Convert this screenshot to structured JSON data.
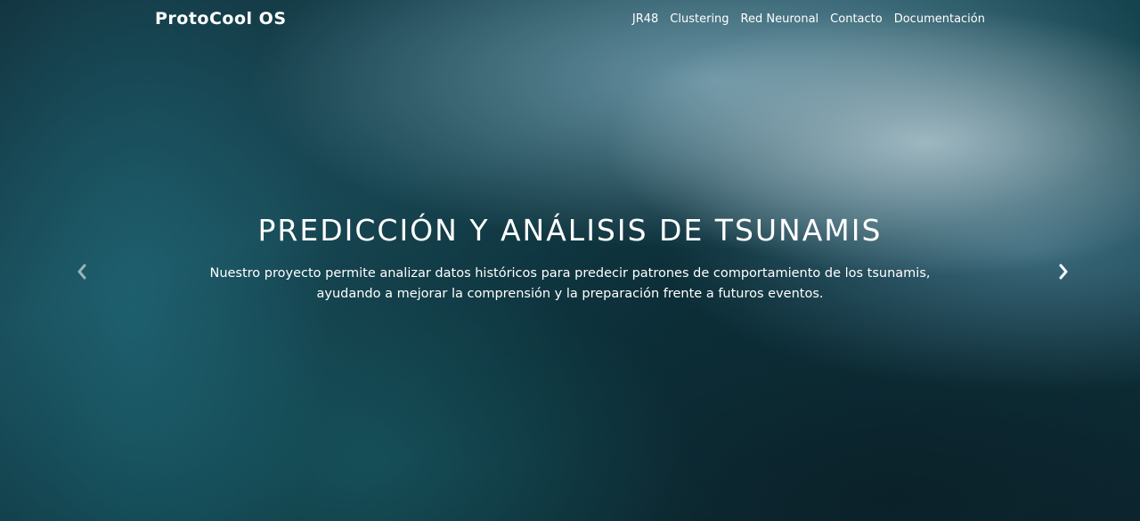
{
  "navbar": {
    "brand": "ProtoCool OS",
    "links": [
      {
        "label": "JR48"
      },
      {
        "label": "Clustering"
      },
      {
        "label": "Red Neuronal"
      },
      {
        "label": "Contacto"
      },
      {
        "label": "Documentación"
      }
    ]
  },
  "hero": {
    "title": "PREDICCIÓN Y ANÁLISIS DE TSUNAMIS",
    "description_line1": "Nuestro proyecto permite analizar datos históricos para predecir patrones de comportamiento de los tsunamis,",
    "description_line2": "ayudando a mejorar la comprensión y la preparación frente a futuros eventos."
  },
  "carousel": {
    "prev_icon": "chevron-left-icon",
    "next_icon": "chevron-right-icon"
  },
  "colors": {
    "text": "#ffffff",
    "background_dark": "#0f303a",
    "background_teal": "#1d5563"
  }
}
